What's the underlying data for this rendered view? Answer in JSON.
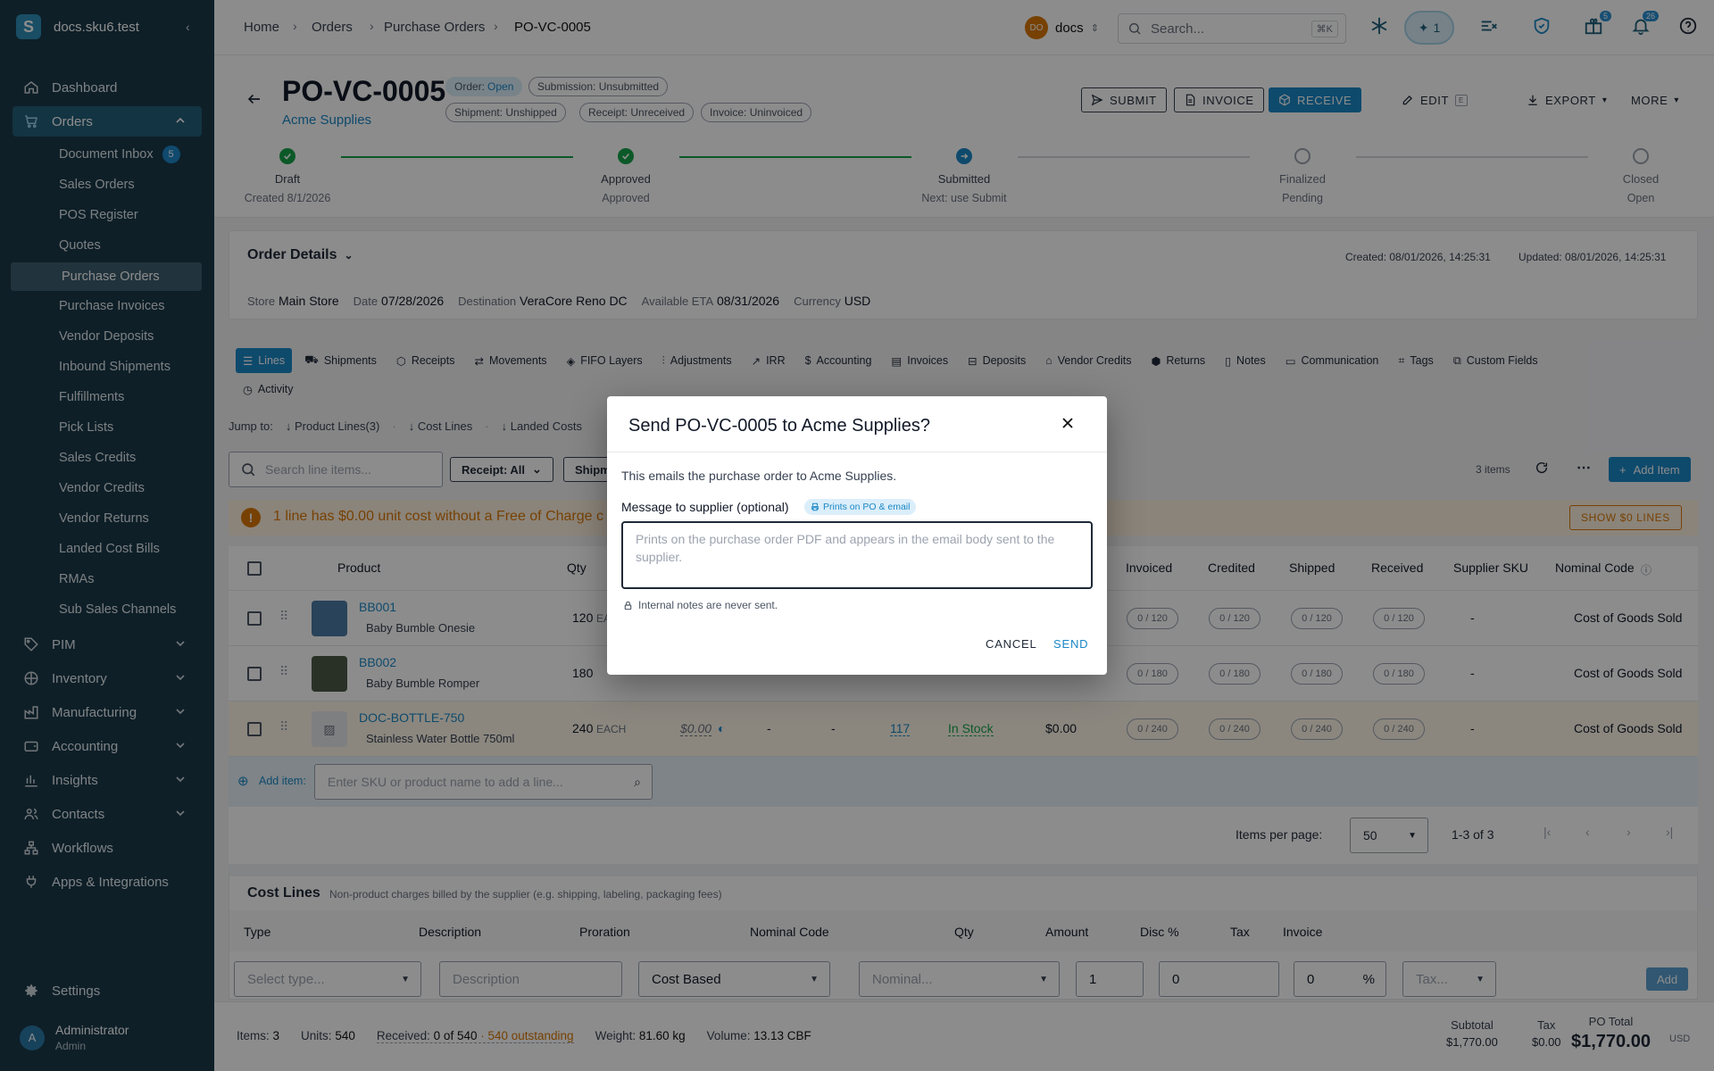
{
  "sidebar": {
    "brand": "docs.sku6.test",
    "nav": [
      {
        "label": "Dashboard",
        "icon": "home-icon"
      },
      {
        "label": "Orders",
        "icon": "cart-icon"
      },
      {
        "label": "PIM",
        "icon": "tag-icon"
      },
      {
        "label": "Inventory",
        "icon": "box-icon"
      },
      {
        "label": "Manufacturing",
        "icon": "factory-icon"
      },
      {
        "label": "Accounting",
        "icon": "wallet-icon"
      },
      {
        "label": "Insights",
        "icon": "chart-icon"
      },
      {
        "label": "Contacts",
        "icon": "people-icon"
      },
      {
        "label": "Workflows",
        "icon": "workflow-icon"
      },
      {
        "label": "Apps & Integrations",
        "icon": "plug-icon"
      }
    ],
    "orders_sub": [
      "Document Inbox",
      "Sales Orders",
      "POS Register",
      "Quotes",
      "Purchase Orders",
      "Purchase Invoices",
      "Vendor Deposits",
      "Inbound Shipments",
      "Fulfillments",
      "Pick Lists",
      "Sales Credits",
      "Vendor Credits",
      "Vendor Returns",
      "Landed Cost Bills",
      "RMAs",
      "Sub Sales Channels"
    ],
    "inbox_count": "5",
    "settings": "Settings",
    "user": {
      "initial": "A",
      "name": "Administrator",
      "role": "Admin"
    }
  },
  "topbar": {
    "breadcrumbs": [
      "Home",
      "Orders",
      "Purchase Orders",
      "PO-VC-0005"
    ],
    "workspace_initials": "DO",
    "workspace": "docs",
    "search_placeholder": "Search...",
    "search_shortcut": "⌘K",
    "ai_count": "1",
    "gift_count": "5",
    "notif_count": "26"
  },
  "header": {
    "po_number": "PO-VC-0005",
    "supplier": "Acme Supplies",
    "status_order_label": "Order:",
    "status_order_value": "Open",
    "submission": "Submission: Unsubmitted",
    "shipment": "Shipment: Unshipped",
    "receipt": "Receipt: Unreceived",
    "invoice": "Invoice: Uninvoiced",
    "buttons": {
      "submit": "SUBMIT",
      "invoice": "INVOICE",
      "receive": "RECEIVE",
      "edit": "EDIT",
      "edit_kbd": "E",
      "export": "EXPORT",
      "more": "MORE"
    },
    "steps": [
      {
        "label": "Draft",
        "sub": "Created 8/1/2026",
        "state": "done"
      },
      {
        "label": "Approved",
        "sub": "Approved",
        "state": "done"
      },
      {
        "label": "Submitted",
        "sub": "Next: use Submit",
        "state": "current"
      },
      {
        "label": "Finalized",
        "sub": "Pending",
        "state": "pending"
      },
      {
        "label": "Closed",
        "sub": "Open",
        "state": "pending"
      }
    ]
  },
  "details": {
    "title": "Order Details",
    "created": "Created: 08/01/2026, 14:25:31",
    "updated": "Updated: 08/01/2026, 14:25:31",
    "store_label": "Store",
    "store": "Main Store",
    "date_label": "Date",
    "date": "07/28/2026",
    "dest_label": "Destination",
    "dest": "VeraCore Reno DC",
    "eta_label": "Available ETA",
    "eta": "08/31/2026",
    "currency_label": "Currency",
    "currency": "USD"
  },
  "tabs": [
    "Lines",
    "Shipments",
    "Receipts",
    "Movements",
    "FIFO Layers",
    "Adjustments",
    "IRR",
    "Accounting",
    "Invoices",
    "Deposits",
    "Vendor Credits",
    "Returns",
    "Notes",
    "Communication",
    "Tags",
    "Custom Fields",
    "Activity"
  ],
  "jump": {
    "label": "Jump to:",
    "items": [
      "Product Lines(3)",
      "Cost Lines",
      "Landed Costs"
    ]
  },
  "lines_toolbar": {
    "search_placeholder": "Search line items...",
    "receipt_filter": "Receipt: All",
    "shipment_filter": "Shipm",
    "count": "3 items",
    "add_item": "Add Item"
  },
  "warning": {
    "text": "1 line has $0.00 unit cost without a Free of Charge c",
    "button": "SHOW $0 LINES"
  },
  "columns": {
    "product": "Product",
    "qty": "Qty",
    "invoiced": "Invoiced",
    "credited": "Credited",
    "shipped": "Shipped",
    "received": "Received",
    "supplier_sku": "Supplier SKU",
    "nominal": "Nominal Code"
  },
  "rows": [
    {
      "sku": "BB001",
      "name": "Baby Bumble Onesie",
      "qty": "120",
      "unit": "EA",
      "chips": [
        "0 / 120",
        "0 / 120",
        "0 / 120",
        "0 / 120"
      ],
      "supplier_sku": "-",
      "nominal": "Cost of Goods Sold"
    },
    {
      "sku": "BB002",
      "name": "Baby Bumble Romper",
      "qty": "180",
      "unit": "",
      "chips": [
        "0 / 180",
        "0 / 180",
        "0 / 180",
        "0 / 180"
      ],
      "supplier_sku": "-",
      "nominal": "Cost of Goods Sold"
    },
    {
      "sku": "DOC-BOTTLE-750",
      "name": "Stainless Water Bottle 750ml",
      "qty": "240",
      "unit": "EACH",
      "cost": "$0.00",
      "dash1": "-",
      "dash2": "-",
      "avail": "117",
      "stock": "In Stock",
      "total": "$0.00",
      "chips": [
        "0 / 240",
        "0 / 240",
        "0 / 240",
        "0 / 240"
      ],
      "supplier_sku": "-",
      "nominal": "Cost of Goods Sold"
    }
  ],
  "add_item": {
    "label": "Add item:",
    "placeholder": "Enter SKU or product name to add a line..."
  },
  "pagination": {
    "per_page_label": "Items per page:",
    "per_page": "50",
    "range": "1-3 of 3"
  },
  "cost_lines": {
    "title": "Cost Lines",
    "subtitle": "Non-product charges billed by the supplier (e.g. shipping, labeling, packaging fees)",
    "headers": [
      "Type",
      "Description",
      "Proration",
      "Nominal Code",
      "Qty",
      "Amount",
      "Disc %",
      "Tax",
      "Invoice"
    ],
    "type_placeholder": "Select type...",
    "desc_placeholder": "Description",
    "proration": "Cost Based",
    "nominal_placeholder": "Nominal...",
    "qty": "1",
    "amount": "0",
    "disc": "0",
    "disc_unit": "%",
    "tax_placeholder": "Tax...",
    "add": "Add"
  },
  "footer": {
    "items_label": "Items:",
    "items": "3",
    "units_label": "Units:",
    "units": "540",
    "received_label": "Received:",
    "received": "0 of 540",
    "outstanding": "· 540 outstanding",
    "weight_label": "Weight:",
    "weight": "81.60 kg",
    "volume_label": "Volume:",
    "volume": "13.13 CBF",
    "subtotal_label": "Subtotal",
    "subtotal": "$1,770.00",
    "tax_label": "Tax",
    "tax": "$0.00",
    "total_label": "PO Total",
    "total": "$1,770.00",
    "currency": "USD"
  },
  "modal": {
    "title": "Send PO-VC-0005 to Acme Supplies?",
    "desc": "This emails the purchase order to Acme Supplies.",
    "label": "Message to supplier (optional)",
    "badge": "Prints on PO & email",
    "placeholder": "Prints on the purchase order PDF and appears in the email body sent to the supplier.",
    "note": "Internal notes are never sent.",
    "cancel": "CANCEL",
    "send": "SEND"
  },
  "colors": {
    "sidebar": "#1a3a4a",
    "accent": "#1a87c5",
    "success": "#16a34a",
    "warning": "#d97706"
  }
}
